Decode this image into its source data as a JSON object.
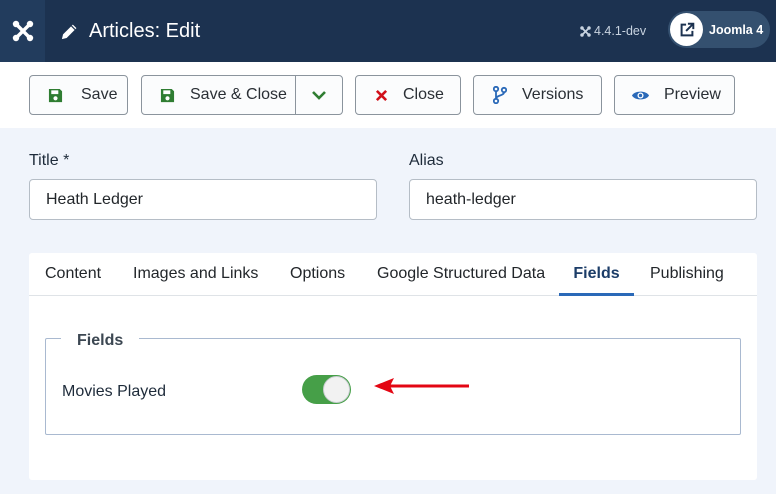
{
  "header": {
    "logo_icon": "joomla-logo-icon",
    "title_icon": "pencil-icon",
    "title": "Articles: Edit",
    "version": "4.4.1-dev",
    "site_button_label": "Joomla 4"
  },
  "toolbar": {
    "save_label": "Save",
    "save_close_label": "Save & Close",
    "close_label": "Close",
    "versions_label": "Versions",
    "preview_label": "Preview"
  },
  "form": {
    "title_label": "Title *",
    "title_value": "Heath Ledger",
    "alias_label": "Alias",
    "alias_value": "heath-ledger"
  },
  "tabs": [
    {
      "label": "Content"
    },
    {
      "label": "Images and Links"
    },
    {
      "label": "Options"
    },
    {
      "label": "Google Structured Data"
    },
    {
      "label": "Fields",
      "active": true
    },
    {
      "label": "Publishing"
    }
  ],
  "fields_panel": {
    "legend": "Fields",
    "field_label": "Movies Played",
    "toggle_on": true
  },
  "colors": {
    "header_bg": "#1c3250",
    "toggle_on": "#469f48",
    "save_icon": "#2f7d32",
    "close_icon": "#d1101a",
    "brand_blue": "#2a69b8",
    "annotation_arrow": "#e30613"
  }
}
